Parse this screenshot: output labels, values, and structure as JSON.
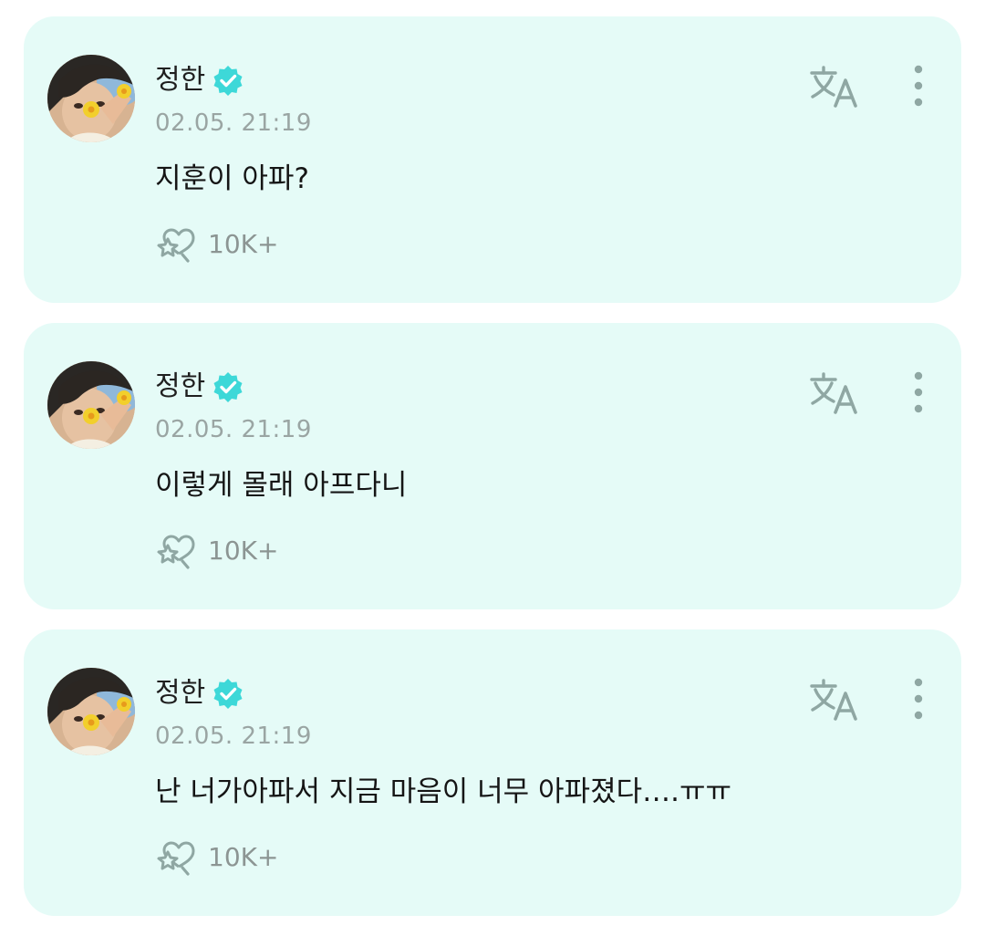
{
  "colors": {
    "card_background": "#e5fbf7",
    "verified_badge": "#3dd8d8",
    "icon_gray": "#8fa7a3",
    "timestamp": "#9aa5a3"
  },
  "posts": [
    {
      "author": "정한",
      "timestamp": "02.05. 21:19",
      "message": "지훈이 아파?",
      "like_count": "10K+"
    },
    {
      "author": "정한",
      "timestamp": "02.05. 21:19",
      "message": "이렇게 몰래 아프다니",
      "like_count": "10K+"
    },
    {
      "author": "정한",
      "timestamp": "02.05. 21:19",
      "message": "난 너가아파서 지금 마음이 너무 아파졌다….ㅠㅠ",
      "like_count": "10K+"
    }
  ],
  "icons": {
    "verified": "verified-badge-icon",
    "translate": "translate-icon",
    "more": "more-vertical-icon",
    "like": "star-heart-like-icon"
  }
}
